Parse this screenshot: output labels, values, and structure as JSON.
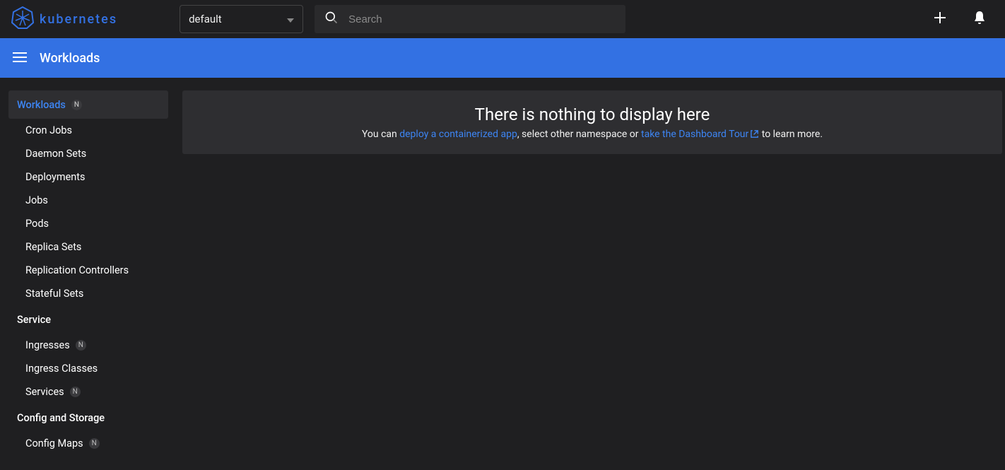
{
  "app": {
    "name": "kubernetes",
    "namespace_selected": "default",
    "search_placeholder": "Search"
  },
  "bluebar": {
    "title": "Workloads"
  },
  "sidebar": {
    "sections": [
      {
        "header": "Workloads",
        "active": true,
        "badge": "N",
        "items": [
          {
            "label": "Cron Jobs"
          },
          {
            "label": "Daemon Sets"
          },
          {
            "label": "Deployments"
          },
          {
            "label": "Jobs"
          },
          {
            "label": "Pods"
          },
          {
            "label": "Replica Sets"
          },
          {
            "label": "Replication Controllers"
          },
          {
            "label": "Stateful Sets"
          }
        ]
      },
      {
        "header": "Service",
        "items": [
          {
            "label": "Ingresses",
            "badge": "N"
          },
          {
            "label": "Ingress Classes"
          },
          {
            "label": "Services",
            "badge": "N"
          }
        ]
      },
      {
        "header": "Config and Storage",
        "items": [
          {
            "label": "Config Maps",
            "badge": "N"
          }
        ]
      }
    ]
  },
  "empty": {
    "title": "There is nothing to display here",
    "pre": "You can ",
    "deploy_link": "deploy a containerized app",
    "mid": ", select other namespace or ",
    "tour_link": "take the Dashboard Tour",
    "post": " to learn more."
  }
}
